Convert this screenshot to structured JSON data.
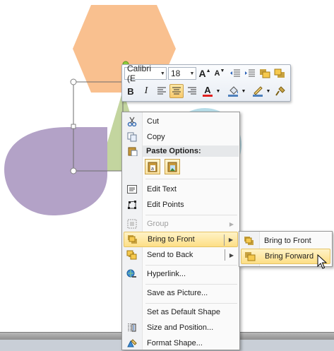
{
  "mini_toolbar": {
    "font_name": "Calibri (E",
    "font_size": "18",
    "icons": [
      "grow-font-icon",
      "shrink-font-icon",
      "decrease-list-level-icon",
      "increase-list-level-icon",
      "bring-forward-icon",
      "send-backward-icon",
      "bold-icon",
      "italic-icon",
      "align-left-icon",
      "align-center-icon",
      "align-right-icon",
      "font-color-icon",
      "shape-fill-icon",
      "shape-outline-icon",
      "format-painter-icon"
    ],
    "bold": "B",
    "italic": "I",
    "font_color_letter": "A"
  },
  "context_menu": {
    "items": [
      {
        "label": "Cut",
        "icon": "scissors-icon",
        "enabled": true
      },
      {
        "label": "Copy",
        "icon": "copy-icon",
        "enabled": true
      },
      {
        "label": "Paste Options:",
        "icon": "paste-icon",
        "enabled": true,
        "header": true
      },
      {
        "label": "Edit Text",
        "icon": "edit-text-icon",
        "enabled": true
      },
      {
        "label": "Edit Points",
        "icon": "edit-points-icon",
        "enabled": true
      },
      {
        "label": "Group",
        "icon": "group-icon",
        "enabled": false,
        "submenu": true
      },
      {
        "label": "Bring to Front",
        "icon": "bring-to-front-icon",
        "enabled": true,
        "submenu": true,
        "highlighted": true
      },
      {
        "label": "Send to Back",
        "icon": "send-to-back-icon",
        "enabled": true,
        "submenu": true
      },
      {
        "label": "Hyperlink...",
        "icon": "hyperlink-icon",
        "enabled": true
      },
      {
        "label": "Save as Picture...",
        "icon": "",
        "enabled": true
      },
      {
        "label": "Set as Default Shape",
        "icon": "",
        "enabled": true
      },
      {
        "label": "Size and Position...",
        "icon": "size-position-icon",
        "enabled": true
      },
      {
        "label": "Format Shape...",
        "icon": "format-shape-icon",
        "enabled": true
      }
    ],
    "paste_options": [
      "keep-text-only-icon",
      "paste-picture-icon"
    ]
  },
  "submenu": {
    "items": [
      {
        "label": "Bring to Front",
        "icon": "bring-to-front-icon"
      },
      {
        "label": "Bring Forward",
        "icon": "bring-forward-icon",
        "highlighted": true
      }
    ]
  },
  "colors": {
    "hexagon": "#f9c08f",
    "triangle": "#c3d59f",
    "circle": "#b7dde8",
    "purple_shape": "#b3a2c7",
    "highlight": "#fde18a"
  }
}
